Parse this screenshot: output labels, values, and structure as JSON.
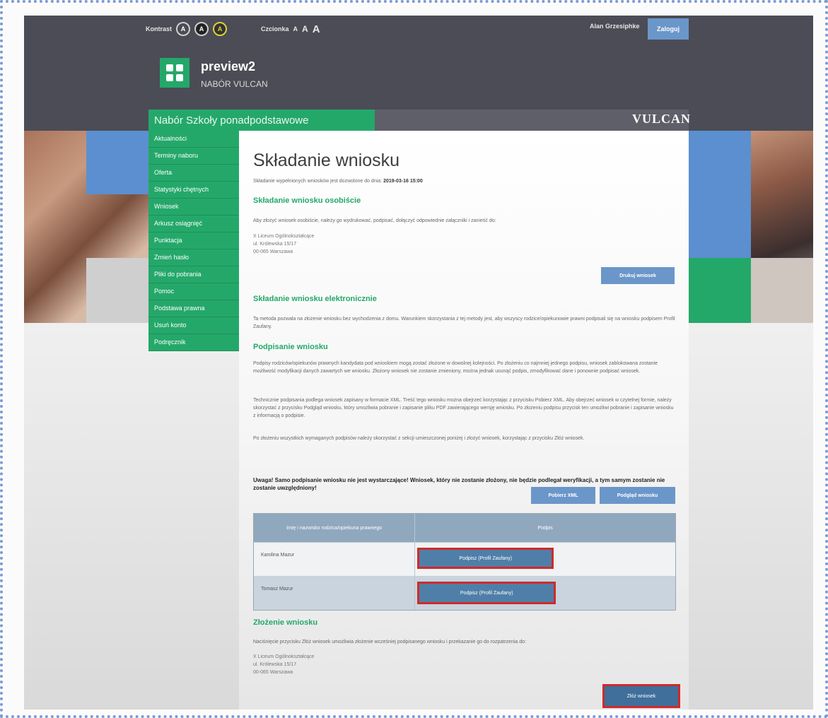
{
  "header": {
    "contrast_label": "Kontrast",
    "contrast_options": [
      "A",
      "A",
      "A"
    ],
    "fontsize_label": "Czcionka",
    "fontsize_options": [
      "A",
      "A",
      "A"
    ],
    "user_name": "Alan Grzesiphke",
    "login_label": "Zaloguj",
    "app_title": "preview2",
    "app_subtitle": "NABÓR VULCAN",
    "nav_title": "Nabór Szkoły ponadpodstawowe",
    "brand": "VULCAN"
  },
  "sidebar": {
    "items": [
      {
        "label": "Aktualności"
      },
      {
        "label": "Terminy naboru"
      },
      {
        "label": "Oferta"
      },
      {
        "label": "Statystyki chętnych"
      },
      {
        "label": "Wniosek"
      },
      {
        "label": "Arkusz osiągnięć"
      },
      {
        "label": "Punktacja"
      },
      {
        "label": "Zmień hasło"
      },
      {
        "label": "Pliki do pobrania"
      },
      {
        "label": "Pomoc"
      },
      {
        "label": "Podstawa prawna"
      },
      {
        "label": "Usuń konto"
      },
      {
        "label": "Podręcznik"
      }
    ]
  },
  "main": {
    "title": "Składanie wniosku",
    "deadline_text": "Składanie wypełnionych wniosków jest dozwolone do dnia:",
    "deadline_value": "2019-03-16 15:00",
    "section1_title": "Składanie wniosku osobiście",
    "section1_text": "Aby złożyć wniosek osobiście, należy go wydrukować, podpisać, dołączyć odpowiednie załączniki i zanieść do:",
    "address1": [
      "X Liceum Ogólnokształcące",
      "ul. Królewska 15/17",
      "00-065 Warszawa"
    ],
    "print_button": "Drukuj wniosek",
    "section2_title": "Składanie wniosku elektronicznie",
    "section2_text": "Ta metoda pozwala na złożenie wniosku bez wychodzenia z domu. Warunkiem skorzystania z tej metody jest, aby wszyscy rodzice/opiekunowie prawni podpisali się na wniosku podpisem Profil Zaufany.",
    "section3_title": "Podpisanie wniosku",
    "section3_text_1": "Podpisy rodziców/opiekunów prawnych kandydata pod wnioskiem mogą zostać złożone w dowolnej kolejności. Po złożeniu co najmniej jednego podpisu, wniosek zablokowana zostanie możliwość modyfikacji danych zawartych we wniosku. Złożony wniosek nie zostanie zmieniony, można jednak usunąć podpis, zmodyfikować dane i ponownie podpisać wniosek.",
    "section3_text_2": "Technicznie podpisania podlega wniosek zapisany w formacie XML. Treść tego wniosku można obejrzeć korzystając z przycisku Pobierz XML. Aby obejrzeć wniosek w czytelnej formie, należy skorzystać z przycisku Podgląd wniosku, który umożliwia pobranie i zapisanie pliku PDF zawierającego wersję wniosku. Po złożeniu podpisu przycisk ten umożliwi pobranie i zapisanie wniosku z informacją o podpisie.",
    "section3_text_3": "Po złożeniu wszystkich wymaganych podpisów należy skorzystać z sekcji umieszczonej poniżej i złożyć wniosek, korzystając z przycisku Złóż wniosek.",
    "bold_note": "Uwaga! Samo podpisanie wniosku nie jest wystarczające! Wniosek, który nie zostanie złożony, nie będzie podlegał weryfikacji, a tym samym zostanie nie zostanie uwzględniony!",
    "xml_button": "Pobierz XML",
    "preview_button": "Podgląd wniosku",
    "table": {
      "headers": [
        "Imię i nazwisko rodzica/opiekuna prawnego",
        "Podpis"
      ],
      "rows": [
        {
          "name": "Karolina Mazur",
          "action": "Podpisz (Profil Zaufany)"
        },
        {
          "name": "Tomasz Mazur",
          "action": "Podpisz (Profil Zaufany)"
        }
      ]
    },
    "section4_title": "Złożenie wniosku",
    "section4_text": "Naciśnięcie przycisku Złóż wniosek umożliwia złożenie wcześniej podpisanego wniosku i przekazanie go do rozpatrzenia do:",
    "address2": [
      "X Liceum Ogólnokształcące",
      "ul. Królewska 15/17",
      "00-065 Warszawa"
    ],
    "submit_button": "Złóż wniosek"
  }
}
